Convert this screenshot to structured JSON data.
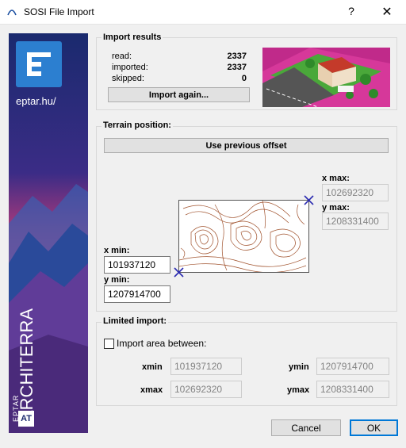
{
  "window": {
    "title": "SOSI File Import",
    "help_label": "?",
    "close_label": "✕"
  },
  "banner": {
    "site": "eptar.hu/",
    "brand_small": "EPTAR",
    "brand_large": "ARCHITERRA",
    "at_mark": "AT"
  },
  "import_results": {
    "label": "Import results",
    "read_label": "read:",
    "read_value": "2337",
    "imported_label": "imported:",
    "imported_value": "2337",
    "skipped_label": "skipped:",
    "skipped_value": "0",
    "import_again_label": "Import again..."
  },
  "terrain": {
    "label": "Terrain position:",
    "use_previous_label": "Use previous offset",
    "xmax_label": "x max:",
    "xmax_value": "102692320",
    "ymax_label": "y max:",
    "ymax_value": "1208331400",
    "xmin_label": "x min:",
    "xmin_value": "101937120",
    "ymin_label": "y min:",
    "ymin_value": "1207914700"
  },
  "limited": {
    "label": "Limited import:",
    "checkbox_label": "Import area between:",
    "xmin_label": "xmin",
    "xmin_value": "101937120",
    "xmax_label": "xmax",
    "xmax_value": "102692320",
    "ymin_label": "ymin",
    "ymin_value": "1207914700",
    "ymax_label": "ymax",
    "ymax_value": "1208331400"
  },
  "footer": {
    "cancel_label": "Cancel",
    "ok_label": "OK"
  },
  "colors": {
    "accent": "#0078d7",
    "contour": "#a0522d",
    "marker": "#2a2ab0"
  }
}
